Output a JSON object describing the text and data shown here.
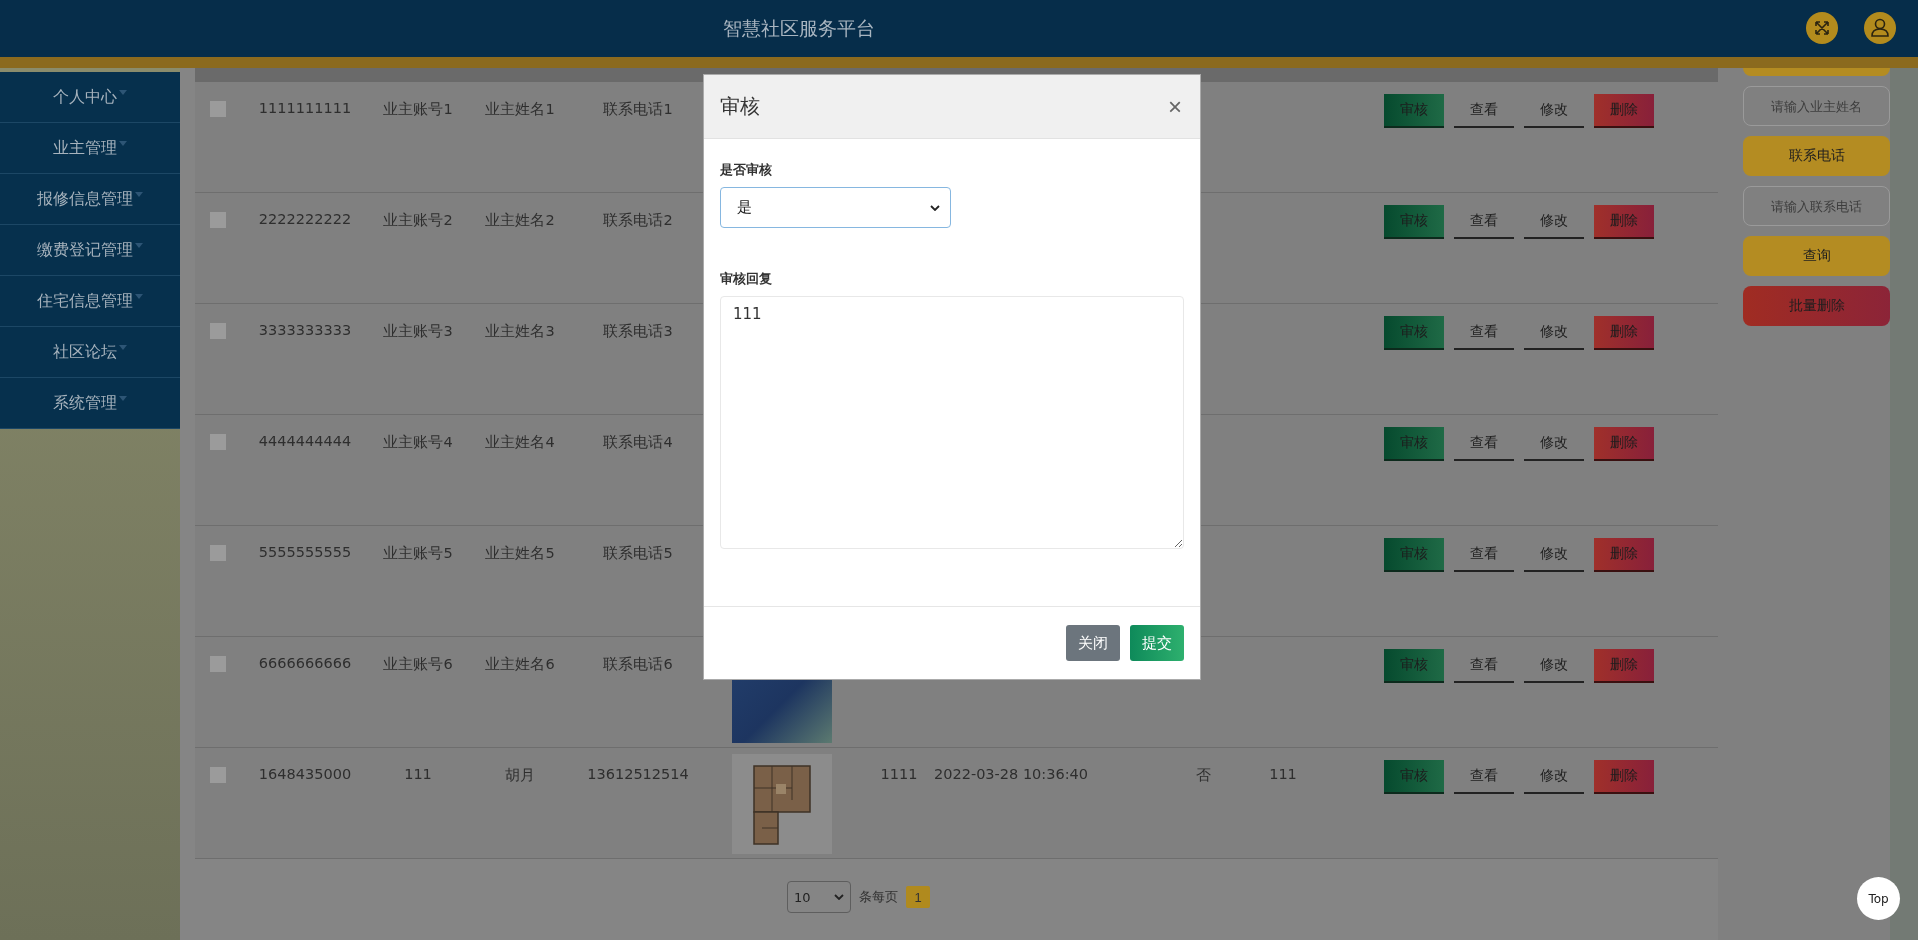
{
  "header": {
    "title": "智慧社区服务平台"
  },
  "sidebar": {
    "items": [
      {
        "label": "个人中心"
      },
      {
        "label": "业主管理"
      },
      {
        "label": "报修信息管理"
      },
      {
        "label": "缴费登记管理"
      },
      {
        "label": "住宅信息管理"
      },
      {
        "label": "社区论坛"
      },
      {
        "label": "系统管理"
      }
    ]
  },
  "table": {
    "rows": [
      {
        "checked": false,
        "id": "1111111111",
        "account": "业主账号1",
        "name": "业主姓名1",
        "phone": "联系电话1",
        "actions": [
          {
            "kind": "audit",
            "label": "审核"
          },
          {
            "kind": "view",
            "label": "查看"
          },
          {
            "kind": "edit",
            "label": "修改"
          },
          {
            "kind": "delete",
            "label": "删除"
          }
        ]
      },
      {
        "checked": false,
        "id": "2222222222",
        "account": "业主账号2",
        "name": "业主姓名2",
        "phone": "联系电话2",
        "actions": [
          {
            "kind": "audit",
            "label": "审核"
          },
          {
            "kind": "view",
            "label": "查看"
          },
          {
            "kind": "edit",
            "label": "修改"
          },
          {
            "kind": "delete",
            "label": "删除"
          }
        ]
      },
      {
        "checked": false,
        "id": "3333333333",
        "account": "业主账号3",
        "name": "业主姓名3",
        "phone": "联系电话3",
        "actions": [
          {
            "kind": "audit",
            "label": "审核"
          },
          {
            "kind": "view",
            "label": "查看"
          },
          {
            "kind": "edit",
            "label": "修改"
          },
          {
            "kind": "delete",
            "label": "删除"
          }
        ]
      },
      {
        "checked": false,
        "id": "4444444444",
        "account": "业主账号4",
        "name": "业主姓名4",
        "phone": "联系电话4",
        "actions": [
          {
            "kind": "audit",
            "label": "审核"
          },
          {
            "kind": "view",
            "label": "查看"
          },
          {
            "kind": "edit",
            "label": "修改"
          },
          {
            "kind": "delete",
            "label": "删除"
          }
        ]
      },
      {
        "checked": false,
        "id": "5555555555",
        "account": "业主账号5",
        "name": "业主姓名5",
        "phone": "联系电话5",
        "actions": [
          {
            "kind": "audit",
            "label": "审核"
          },
          {
            "kind": "view",
            "label": "查看"
          },
          {
            "kind": "edit",
            "label": "修改"
          },
          {
            "kind": "delete",
            "label": "删除"
          }
        ]
      },
      {
        "checked": false,
        "id": "6666666666",
        "account": "业主账号6",
        "name": "业主姓名6",
        "phone": "联系电话6",
        "picture": {
          "kind": "photo"
        },
        "actions": [
          {
            "kind": "audit",
            "label": "审核"
          },
          {
            "kind": "view",
            "label": "查看"
          },
          {
            "kind": "edit",
            "label": "修改"
          },
          {
            "kind": "delete",
            "label": "删除"
          }
        ]
      },
      {
        "checked": false,
        "id": "1648435000",
        "account": "111",
        "name": "胡月",
        "phone": "13612512514",
        "picture": {
          "kind": "floor-plan"
        },
        "column_7": "1111",
        "time": "2022-03-28 10:36:40",
        "status": "否",
        "reply": "111",
        "actions": [
          {
            "kind": "audit",
            "label": "审核"
          },
          {
            "kind": "view",
            "label": "查看"
          },
          {
            "kind": "edit",
            "label": "修改"
          },
          {
            "kind": "delete",
            "label": "删除"
          }
        ]
      }
    ]
  },
  "search_panel": [
    {
      "kind": "gold-button"
    },
    {
      "kind": "input",
      "placeholder": "请输入业主姓名"
    },
    {
      "kind": "gold-button",
      "label": "联系电话"
    },
    {
      "kind": "input",
      "placeholder": "请输入联系电话"
    },
    {
      "kind": "gold-button",
      "label": "查询"
    },
    {
      "kind": "red-button",
      "label": "批量删除"
    }
  ],
  "pagination": {
    "page_size": "10",
    "per_page_label": "条每页",
    "pages": [
      {
        "label": "1",
        "selected": true
      }
    ]
  },
  "modal": {
    "title": "审核",
    "close": "×",
    "fields": [
      {
        "kind": "select",
        "label": "是否审核",
        "value": "是"
      },
      {
        "kind": "textarea",
        "label": "审核回复",
        "value": "111"
      }
    ],
    "buttons": [
      {
        "kind": "secondary",
        "label": "关闭"
      },
      {
        "kind": "primary",
        "label": "提交"
      }
    ]
  },
  "back_to_top": {
    "label": "Top"
  }
}
